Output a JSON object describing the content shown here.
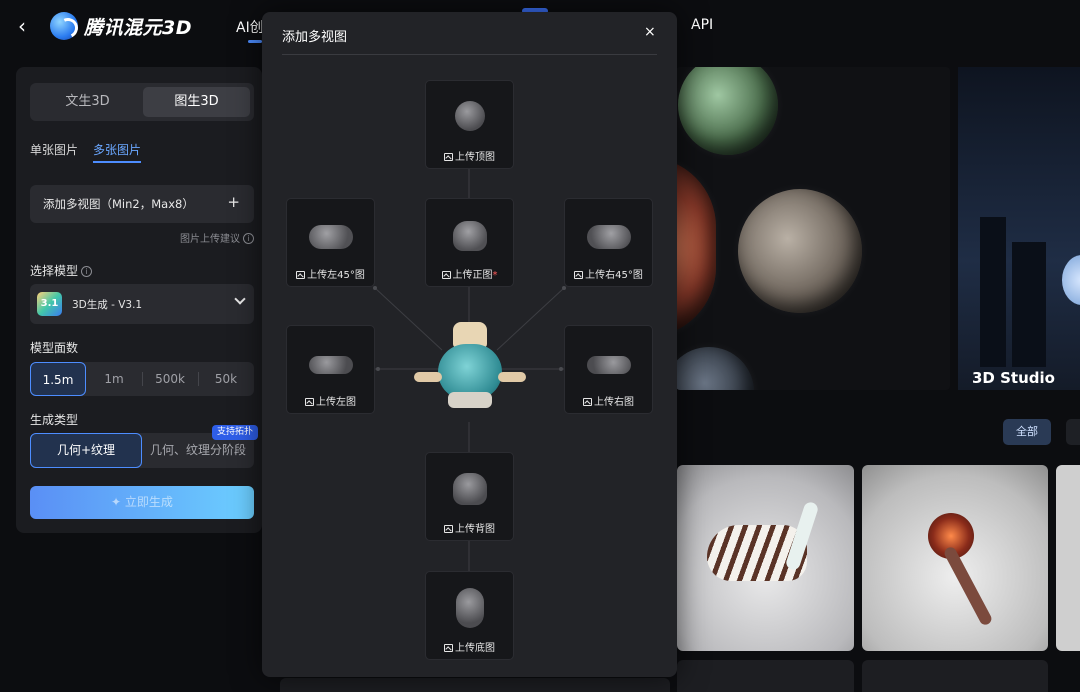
{
  "topbar": {
    "brand": "腾讯混元3D",
    "nav_ai": "AI创",
    "nav_api": "API"
  },
  "left_panel": {
    "mode_tabs": [
      "文生3D",
      "图生3D"
    ],
    "active_mode": "图生3D",
    "sub_tabs": [
      "单张图片",
      "多张图片"
    ],
    "active_sub_tab": "多张图片",
    "add_views_label": "添加多视图（Min2，Max8）",
    "add_views_plus": "+",
    "upload_tips": "图片上传建议",
    "model_section_label": "选择模型",
    "model_badge": "3.1",
    "model_name": "3D生成 - V3.1",
    "face_section_label": "模型面数",
    "face_options": [
      "1.5m",
      "1m",
      "500k",
      "50k"
    ],
    "face_selected": "1.5m",
    "gen_section_label": "生成类型",
    "gen_types": [
      "几何+纹理",
      "几何、纹理分阶段"
    ],
    "gen_selected": "几何+纹理",
    "topology_badge": "支持拓扑",
    "generate_button": "立即生成"
  },
  "modal": {
    "title": "添加多视图",
    "close": "×",
    "slots": {
      "top": "上传顶图",
      "left45": "上传左45°图",
      "front": "上传正图",
      "front_required": "*",
      "right45": "上传右45°图",
      "left": "上传左图",
      "right": "上传右图",
      "back": "上传背图",
      "bottom": "上传底图"
    }
  },
  "gallery": {
    "studio_title": "3D Studio",
    "filter_all": "全部"
  }
}
